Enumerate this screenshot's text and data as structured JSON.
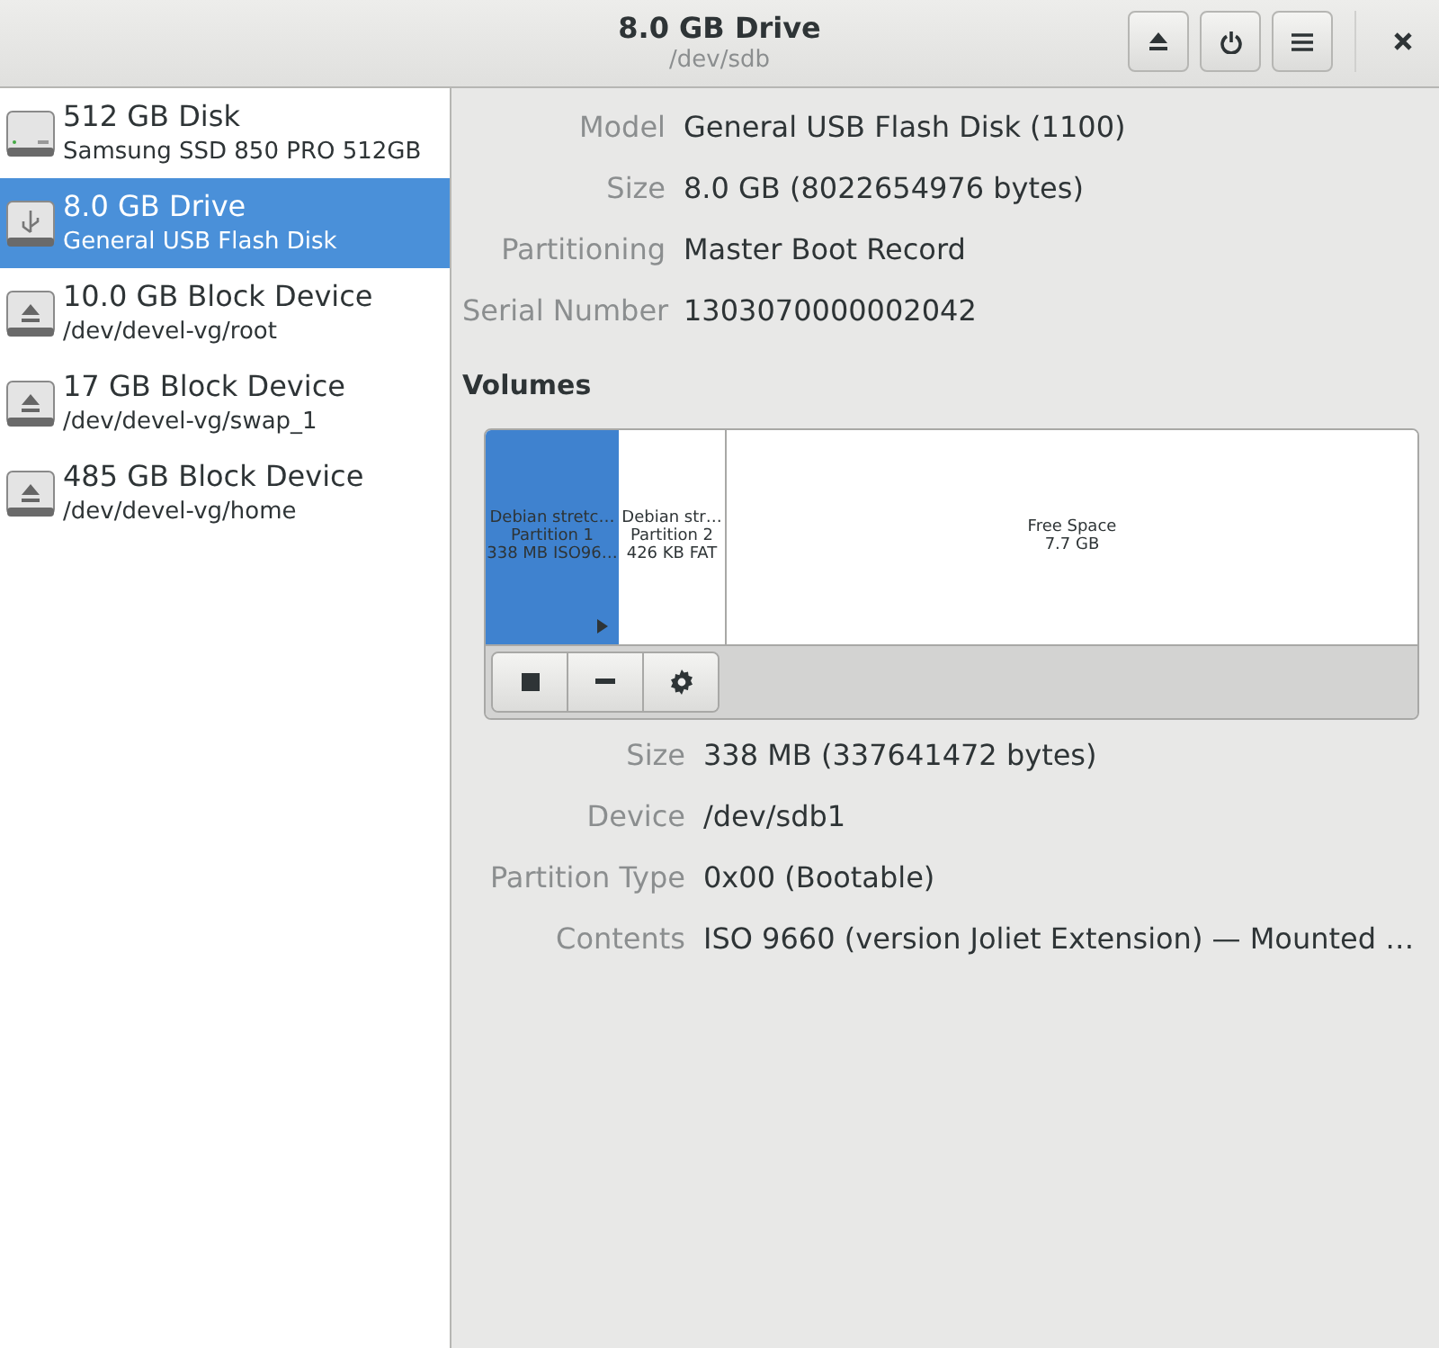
{
  "header": {
    "title": "8.0 GB Drive",
    "subtitle": "/dev/sdb"
  },
  "devices": [
    {
      "kind": "disk",
      "name": "512 GB Disk",
      "detail": "Samsung SSD 850 PRO 512GB",
      "selected": false
    },
    {
      "kind": "usb",
      "name": "8.0 GB Drive",
      "detail": "General USB Flash Disk",
      "selected": true
    },
    {
      "kind": "block",
      "name": "10.0 GB Block Device",
      "detail": "/dev/devel-vg/root",
      "selected": false
    },
    {
      "kind": "block",
      "name": "17 GB Block Device",
      "detail": "/dev/devel-vg/swap_1",
      "selected": false
    },
    {
      "kind": "block",
      "name": "485 GB Block Device",
      "detail": "/dev/devel-vg/home",
      "selected": false
    }
  ],
  "drive_properties": [
    {
      "label": "Model",
      "value": "General USB Flash Disk (1100)"
    },
    {
      "label": "Size",
      "value": "8.0 GB (8022654976 bytes)"
    },
    {
      "label": "Partitioning",
      "value": "Master Boot Record"
    },
    {
      "label": "Serial Number",
      "value": "1303070000002042"
    }
  ],
  "volumes": {
    "heading": "Volumes",
    "segments": [
      {
        "kind": "partition",
        "lines": [
          "Debian stretc…",
          "Partition 1",
          "338 MB ISO96…"
        ],
        "selected": true
      },
      {
        "kind": "partition",
        "lines": [
          "Debian str…",
          "Partition 2",
          "426 KB FAT"
        ],
        "selected": false
      },
      {
        "kind": "free",
        "lines": [
          "Free Space",
          "7.7 GB"
        ],
        "selected": false
      }
    ]
  },
  "volume_properties": [
    {
      "label": "Size",
      "value": "338 MB (337641472 bytes)"
    },
    {
      "label": "Device",
      "value": "/dev/sdb1"
    },
    {
      "label": "Partition Type",
      "value": "0x00 (Bootable)"
    },
    {
      "label": "Contents",
      "value": "ISO 9660 (version Joliet Extension) — Mounted …"
    }
  ]
}
